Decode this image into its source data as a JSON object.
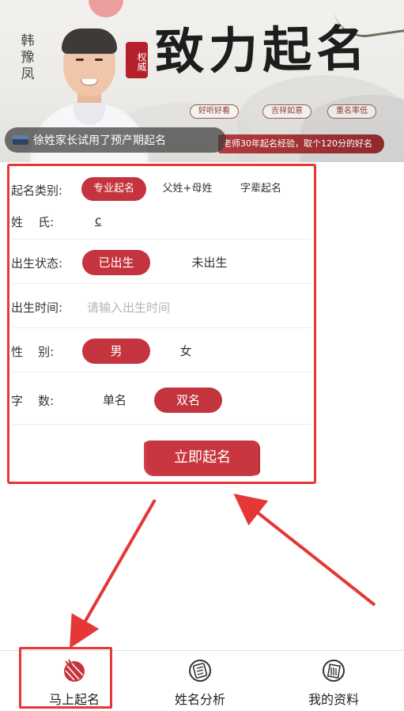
{
  "banner": {
    "person_name": "韩豫凤",
    "seal_text": "权威",
    "title": "致力起名",
    "tags": [
      "好听好看",
      "吉祥如意",
      "重名率低"
    ],
    "ribbon_text": "老师30年起名经验，取个120分的好名",
    "toast": "徐姓家长试用了预产期起名"
  },
  "form": {
    "type_label": "起名类别:",
    "type_options": [
      "专业起名",
      "父姓+母姓",
      "字辈起名"
    ],
    "type_selected": "专业起名",
    "surname_label": "姓    氏:",
    "surname_value": "c",
    "birth_status_label": "出生状态:",
    "birth_status_options": [
      "已出生",
      "未出生"
    ],
    "birth_status_selected": "已出生",
    "birth_time_label": "出生时间:",
    "birth_time_placeholder": "请输入出生时间",
    "gender_label": "性    别:",
    "gender_options": [
      "男",
      "女"
    ],
    "gender_selected": "男",
    "char_count_label": "字    数:",
    "char_count_options": [
      "单名",
      "双名"
    ],
    "char_count_selected": "双名",
    "submit_label": "立即起名"
  },
  "bottom_nav": [
    {
      "label": "马上起名",
      "icon": "brush-icon",
      "active": true
    },
    {
      "label": "姓名分析",
      "icon": "scroll-icon",
      "active": false
    },
    {
      "label": "我的资料",
      "icon": "book-icon",
      "active": false
    }
  ],
  "colors": {
    "accent": "#c4343f",
    "annotation": "#e53735"
  }
}
